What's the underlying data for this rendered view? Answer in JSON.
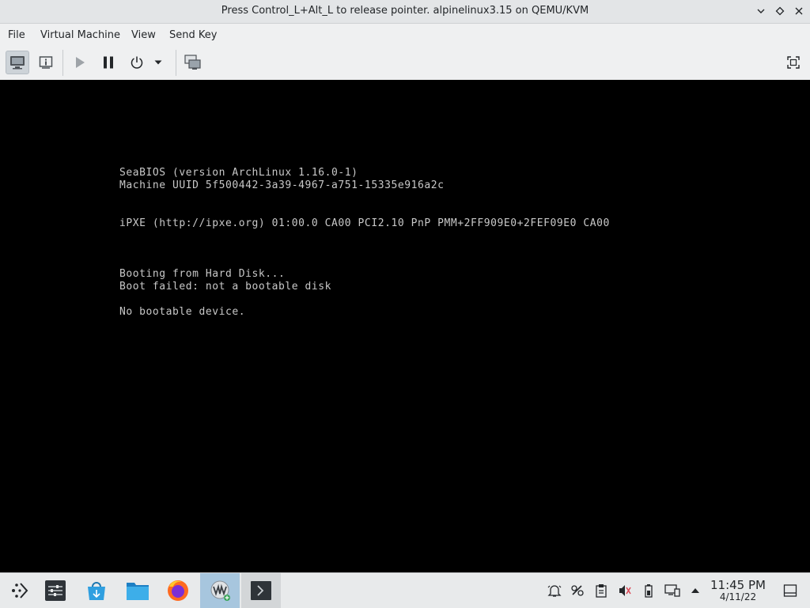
{
  "window": {
    "title": "Press Control_L+Alt_L to release pointer. alpinelinux3.15 on QEMU/KVM",
    "controls": [
      "minimize-icon",
      "maximize-icon",
      "close-icon"
    ]
  },
  "menu": {
    "file": "File",
    "virtual_machine": "Virtual Machine",
    "view": "View",
    "send_key": "Send Key"
  },
  "toolbar": {
    "buttons": [
      "console-view",
      "details-view",
      "run",
      "pause",
      "shutdown",
      "shutdown-menu",
      "snapshots",
      "fullscreen"
    ]
  },
  "console": {
    "lines": [
      "SeaBIOS (version ArchLinux 1.16.0-1)",
      "Machine UUID 5f500442-3a39-4967-a751-15335e916a2c",
      "iPXE (http://ipxe.org) 01:00.0 CA00 PCI2.10 PnP PMM+2FF909E0+2FEF09E0 CA00",
      "Booting from Hard Disk...",
      "Boot failed: not a bootable disk",
      "No bootable device."
    ]
  },
  "taskbar": {
    "apps": [
      "application-launcher",
      "system-settings",
      "discover",
      "file-manager",
      "firefox",
      "virt-manager",
      "konsole"
    ],
    "clock": {
      "time": "11:45 PM",
      "date": "4/11/22"
    }
  },
  "colors": {
    "console_text": "#c8c8c8",
    "console_bg": "#000000",
    "active_task": "#a7c6de"
  }
}
